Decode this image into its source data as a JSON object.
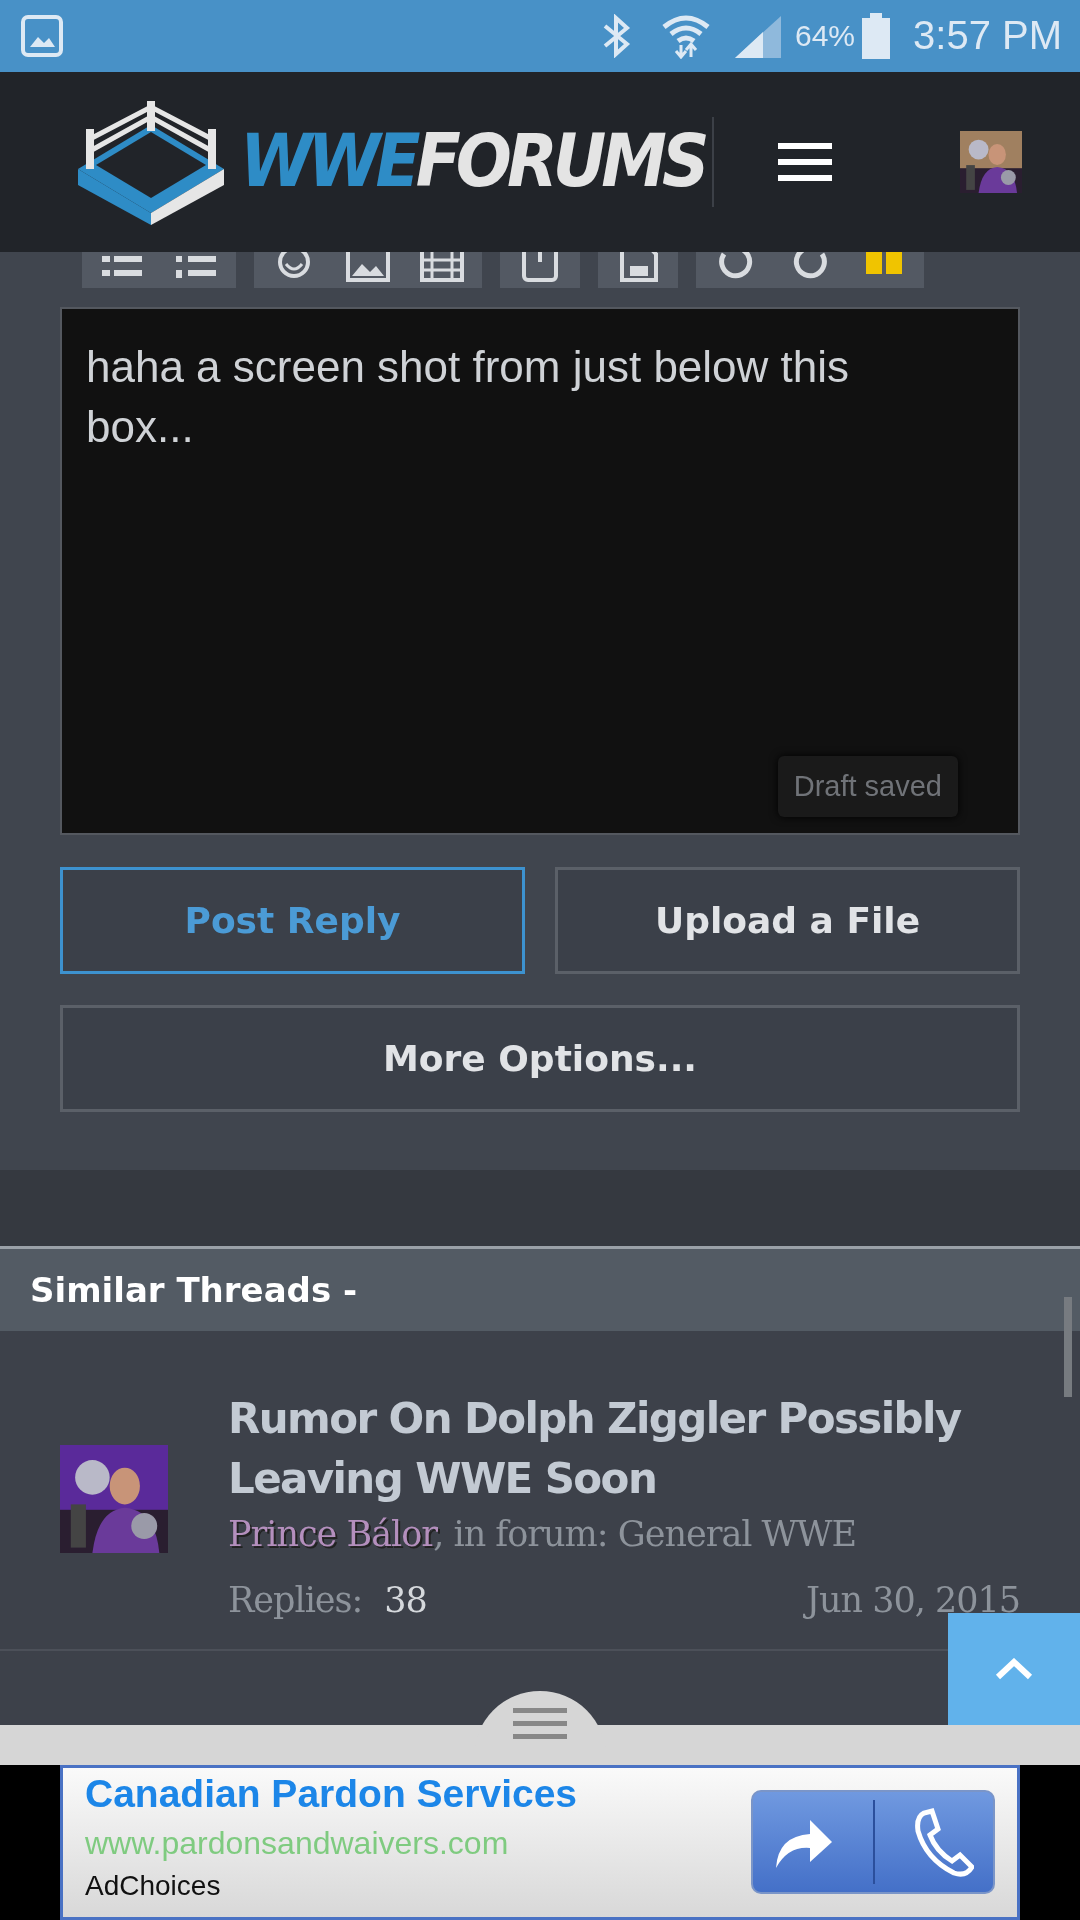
{
  "status_bar": {
    "battery": "64%",
    "time": "3:57 PM"
  },
  "header": {
    "logo_part_1": "WWE",
    "logo_part_2": "FORUMS"
  },
  "editor": {
    "value": "haha a screen shot from just below this box...",
    "draft_status": "Draft saved"
  },
  "buttons": [
    {
      "label": "Post Reply",
      "focused": true
    },
    {
      "label": "Upload a File",
      "focused": false
    }
  ],
  "more_options": "More Options...",
  "similar_threads": {
    "title": "Similar Threads -",
    "threads": [
      {
        "title": "Rumor On Dolph Ziggler Possibly Leaving WWE Soon",
        "author": "Prince Bálor",
        "forum_text": ", in forum: General WWE",
        "replies_label": "Replies:",
        "replies": "38",
        "date": "Jun 30, 2015"
      }
    ]
  },
  "ad": {
    "title": "Canadian Pardon Services",
    "url": "www.pardonsandwaivers.com",
    "adchoices": "AdChoices"
  }
}
